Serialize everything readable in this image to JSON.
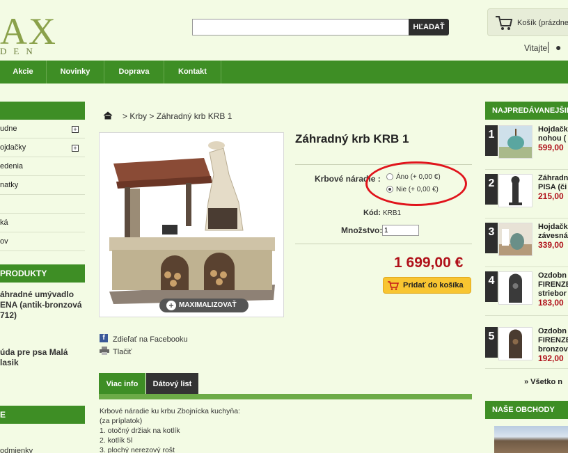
{
  "header": {
    "logo_text": "AX",
    "logo_sub": "DEN",
    "search_placeholder": "",
    "search_button": "HĽADAŤ",
    "cart_label": "Košík (prázdne)",
    "welcome": "Vitajte"
  },
  "nav": {
    "items": [
      "Akcie",
      "Novinky",
      "Doprava",
      "Kontakt"
    ]
  },
  "left": {
    "categories": [
      {
        "label": "udne",
        "plus": "+"
      },
      {
        "label": "ojdačky",
        "plus": "+"
      },
      {
        "label": "edenia",
        "plus": ""
      },
      {
        "label": "natky",
        "plus": ""
      },
      {
        "label": "",
        "plus": ""
      },
      {
        "label": "ká",
        "plus": ""
      },
      {
        "label": "ov",
        "plus": ""
      }
    ],
    "products_head": "PRODUKTY",
    "product1": "áhradné umývadlo ENA (antik-bronzová 712)",
    "product2": "úda pre psa Malá lasik",
    "head3": "E",
    "bottom_text": "odmienky"
  },
  "breadcrumb": {
    "sep": ">",
    "path": "Krby > Záhradný krb KRB 1"
  },
  "product": {
    "title": "Záhradný krb KRB 1",
    "attribute_label": "Krbové náradie :",
    "options": [
      {
        "label": "Áno (+ 0,00 €)",
        "checked": false
      },
      {
        "label": "Nie (+ 0,00 €)",
        "checked": true
      }
    ],
    "code_label": "Kód:",
    "code_value": "KRB1",
    "qty_label": "Množstvo:",
    "qty_value": "1",
    "price": "1 699,00 €",
    "add_to_cart": "Pridať do košíka",
    "zoom_label": "MAXIMALIZOVAŤ",
    "share_facebook": "Zdieľať na Facebooku",
    "print": "Tlačiť"
  },
  "tabs": {
    "more_info": "Viac info",
    "data_sheet": "Dátový list",
    "active_color": "#3e8e25"
  },
  "description": {
    "lines": [
      "Krbové náradie ku krbu Zbojnícka kuchyňa:",
      "(za príplatok)",
      "1. otočný držiak na kotlík",
      "2. kotlík 5l",
      "3. plochý nerezový rošt"
    ]
  },
  "right": {
    "bestsellers_head": "NAJPREDÁVANEJŠIE",
    "items": [
      {
        "rank": "1",
        "name1": "Hojdačk",
        "name2": "nohou (",
        "name3": "",
        "price": "599,00"
      },
      {
        "rank": "2",
        "name1": "Záhradn",
        "name2": "PISA (či",
        "name3": "",
        "price": "215,00"
      },
      {
        "rank": "3",
        "name1": "Hojdačk",
        "name2": "závesná",
        "name3": "",
        "price": "339,00"
      },
      {
        "rank": "4",
        "name1": "Ozdobn",
        "name2": "FIRENZE",
        "name3": "striebor",
        "price": "183,00"
      },
      {
        "rank": "5",
        "name1": "Ozdobn",
        "name2": "FIRENZE",
        "name3": "bronzov",
        "price": "192,00"
      }
    ],
    "all_link": "» Všetko n",
    "stores_head": "NAŠE OBCHODY"
  },
  "colors": {
    "brand_green": "#3e8e25",
    "price_red": "#b0111a",
    "highlight_red": "#e0141c",
    "cart_button": "#f8c531"
  }
}
